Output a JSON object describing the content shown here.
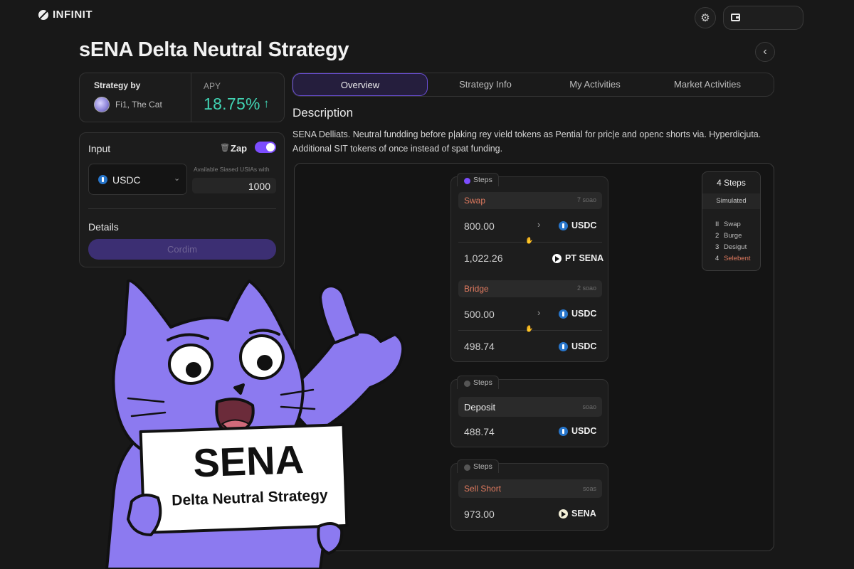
{
  "app": {
    "brand": "INFINIT"
  },
  "page": {
    "title": "sENA Delta Neutral Strategy"
  },
  "strategy": {
    "by_label": "Strategy by",
    "author": "Fi1, The Cat",
    "apy_label": "APY",
    "apy_value": "18.75%"
  },
  "input_panel": {
    "label": "Input",
    "zap_label": "Zap",
    "zap_enabled": true,
    "token": "USDC",
    "available_label": "Available Siased USIAs with",
    "amount": "1000",
    "details_label": "Details",
    "confirm_label": "Cordim"
  },
  "tabs": [
    {
      "label": "Overview",
      "active": true
    },
    {
      "label": "Strategy Info",
      "active": false
    },
    {
      "label": "My Activities",
      "active": false
    },
    {
      "label": "Market Activities",
      "active": false
    }
  ],
  "description": {
    "title": "Description",
    "text": "SENA Delliats. Neutral fundding before p|aking rey vield tokens as Pential for pric|e and openc shorts via.  Hyperdicjuta. Additional SIT tokens of once instead of spat funding."
  },
  "flow": {
    "group1": {
      "tag": "Steps",
      "swap": {
        "title": "Swap",
        "meta": "7 soao",
        "from_amount": "800.00",
        "from_token": "USDC",
        "to_amount": "1,022.26",
        "to_token": "PT SENA"
      },
      "bridge": {
        "title": "Bridge",
        "meta": "2 soao",
        "from_amount": "500.00",
        "from_token": "USDC",
        "to_amount": "498.74",
        "to_token": "USDC"
      }
    },
    "group2": {
      "tag": "Steps",
      "title": "Deposit",
      "meta": "soao",
      "amount": "488.74",
      "token": "USDC"
    },
    "group3": {
      "tag": "Steps",
      "title": "Sell Short",
      "meta": "soas",
      "amount": "973.00",
      "token": "SENA"
    }
  },
  "summary": {
    "title": "4 Steps",
    "status": "Simulated",
    "items": [
      {
        "num": "II",
        "label": "Swap"
      },
      {
        "num": "2",
        "label": "Burge"
      },
      {
        "num": "3",
        "label": "Desigut"
      },
      {
        "num": "4",
        "label": "Selebent"
      }
    ]
  },
  "mascot_sign": {
    "line1": "SENA",
    "line2": "Delta Neutral Strategy"
  },
  "colors": {
    "accent": "#7c4dff",
    "apy_green": "#41d3b3",
    "step_red": "#e07a5f",
    "usdc_blue": "#2775ca",
    "cat_purple": "#8c7af0"
  },
  "icons": {
    "settings": "gear-icon",
    "wallet": "wallet-icon",
    "back": "chevron-left-icon",
    "apy_up": "arrow-up-icon"
  }
}
